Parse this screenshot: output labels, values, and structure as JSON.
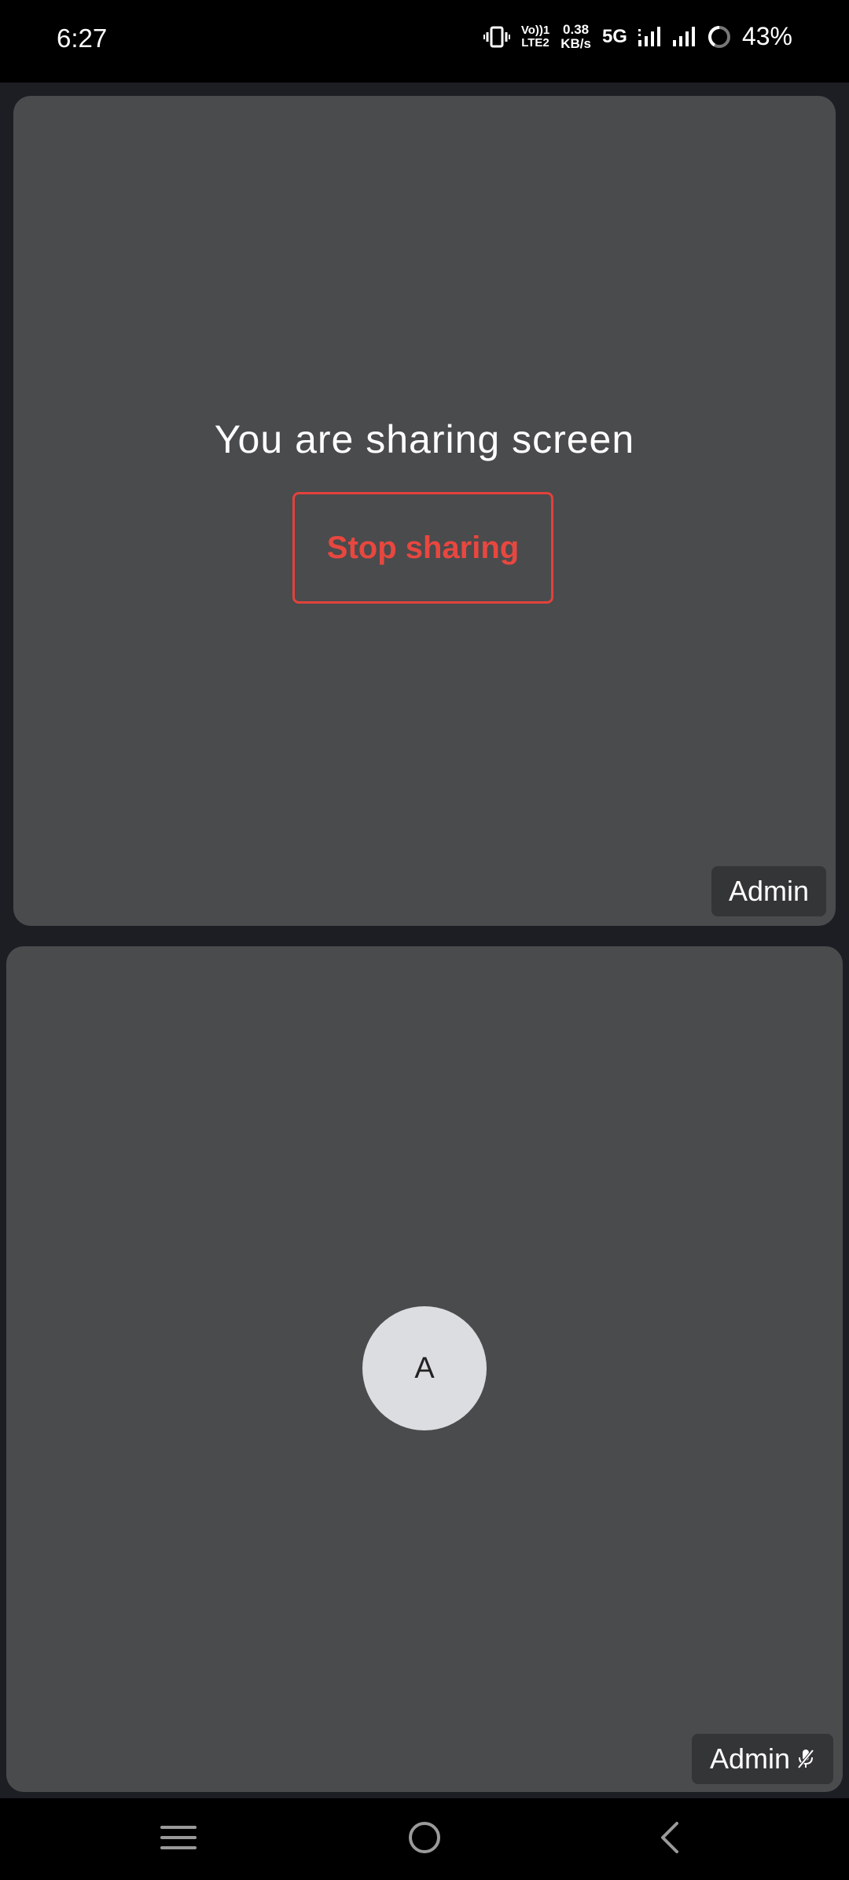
{
  "status_bar": {
    "time": "6:27",
    "volte_line1": "Vo))1",
    "volte_line2": "LTE2",
    "speed_value": "0.38",
    "speed_unit": "KB/s",
    "network": "5G",
    "battery": "43%"
  },
  "share_tile": {
    "message": "You are sharing screen",
    "stop_button_label": "Stop sharing",
    "participant_name": "Admin"
  },
  "participant_tile": {
    "avatar_initial": "A",
    "participant_name": "Admin",
    "mic_status_icon": "mic-off-icon"
  },
  "colors": {
    "tile_bg": "#4a4b4d",
    "stop_accent": "#e2423b",
    "app_bg": "#1d1e24"
  }
}
